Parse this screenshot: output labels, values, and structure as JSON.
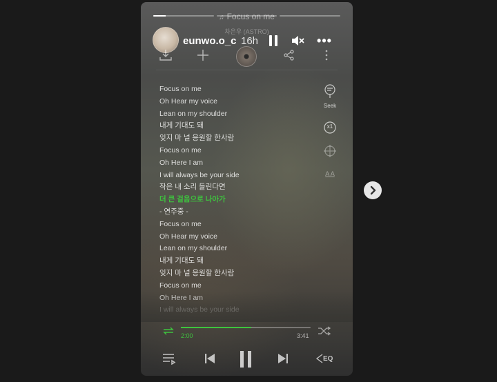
{
  "story": {
    "username": "eunwo.o_c",
    "time_ago": "16h",
    "segments": [
      {
        "progress": 0.2
      },
      {
        "progress": 0
      },
      {
        "progress": 0
      }
    ]
  },
  "player": {
    "note_symbol": "♫",
    "song_title": "Focus on me",
    "artist": "차은우 (ASTRO)",
    "current_time": "2:00",
    "total_time": "3:41",
    "progress": 0.54,
    "seek_label": "Seek",
    "speed_label": "x1",
    "font_label": "A A",
    "eq_label": "EQ"
  },
  "lyrics": [
    {
      "text": "Focus on me",
      "state": "normal"
    },
    {
      "text": "Oh Hear my voice",
      "state": "normal"
    },
    {
      "text": "Lean on my shoulder",
      "state": "normal"
    },
    {
      "text": "내게 기대도 돼",
      "state": "normal"
    },
    {
      "text": "잊지 마 널 응원할 한사람",
      "state": "normal"
    },
    {
      "text": "Focus on me",
      "state": "normal"
    },
    {
      "text": "Oh Here I am",
      "state": "normal"
    },
    {
      "text": "I will always be your side",
      "state": "normal"
    },
    {
      "text": "작은 내 소리 들린다면",
      "state": "normal"
    },
    {
      "text": "더 큰 걸음으로 나아가",
      "state": "active"
    },
    {
      "text": " - 연주중 -",
      "state": "normal"
    },
    {
      "text": "Focus on me",
      "state": "normal"
    },
    {
      "text": "Oh Hear my voice",
      "state": "normal"
    },
    {
      "text": "Lean on my shoulder",
      "state": "normal"
    },
    {
      "text": "내게 기대도 돼",
      "state": "normal"
    },
    {
      "text": "잊지 마 널 응원할 한사람",
      "state": "normal"
    },
    {
      "text": "Focus on me",
      "state": "normal"
    },
    {
      "text": "Oh Here I am",
      "state": "normal"
    },
    {
      "text": "I will always be your side",
      "state": "dim"
    }
  ],
  "colors": {
    "accent": "#3ec43e",
    "page_background": "#1a1a1a"
  },
  "icons": {
    "pause": "pause-icon",
    "mute": "mute-icon",
    "more": "more-icon",
    "download": "download-icon",
    "add": "plus-icon",
    "share": "share-icon",
    "seek": "seek-icon",
    "speed": "speed-icon",
    "next_story": "chevron-right-icon"
  }
}
